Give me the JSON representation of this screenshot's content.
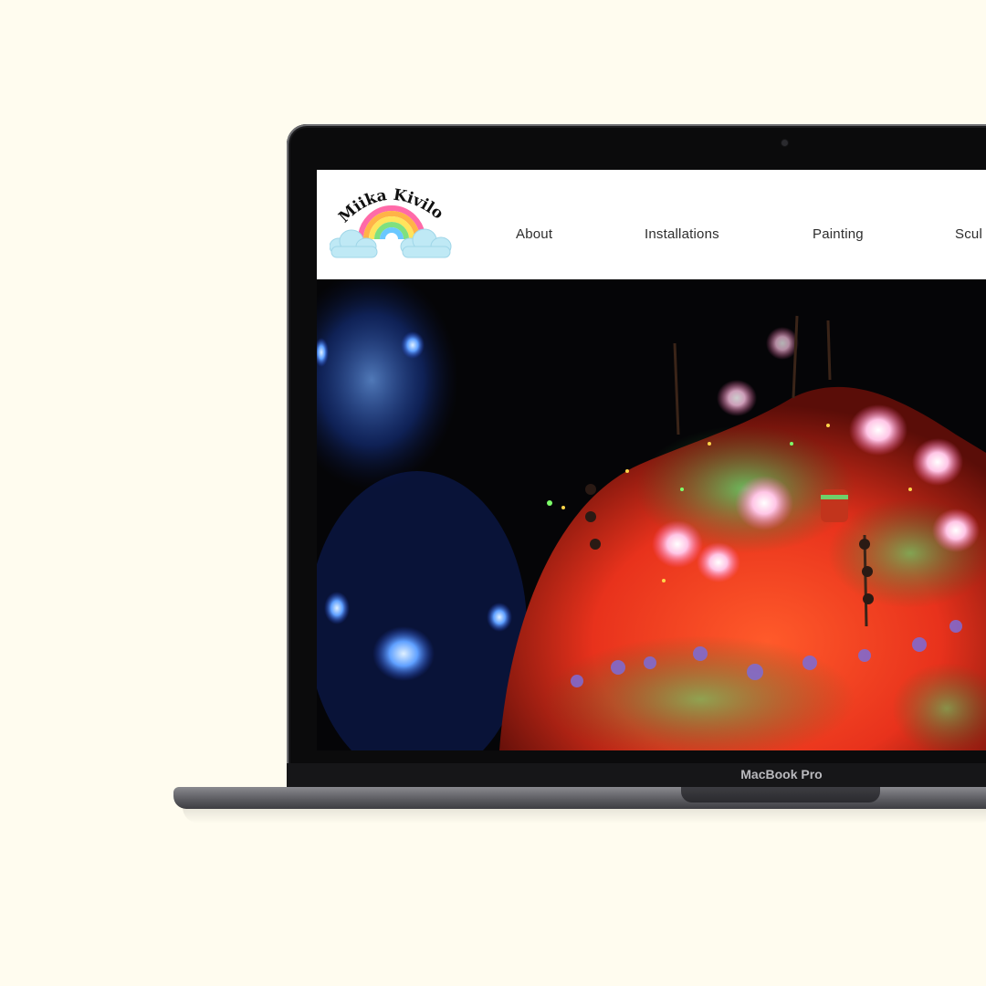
{
  "site": {
    "logo_text": "Miika Kivilo",
    "nav": [
      {
        "label": "About"
      },
      {
        "label": "Installations"
      },
      {
        "label": "Painting"
      },
      {
        "label": "Scul"
      }
    ]
  },
  "device": {
    "model_label": "MacBook Pro"
  },
  "colors": {
    "page_background": "#fffcef",
    "nav_text": "#2d2d2d",
    "hero_background": "#050507"
  },
  "icons": {
    "logo": "rainbow-clouds-logo",
    "camera": "webcam-dot"
  }
}
